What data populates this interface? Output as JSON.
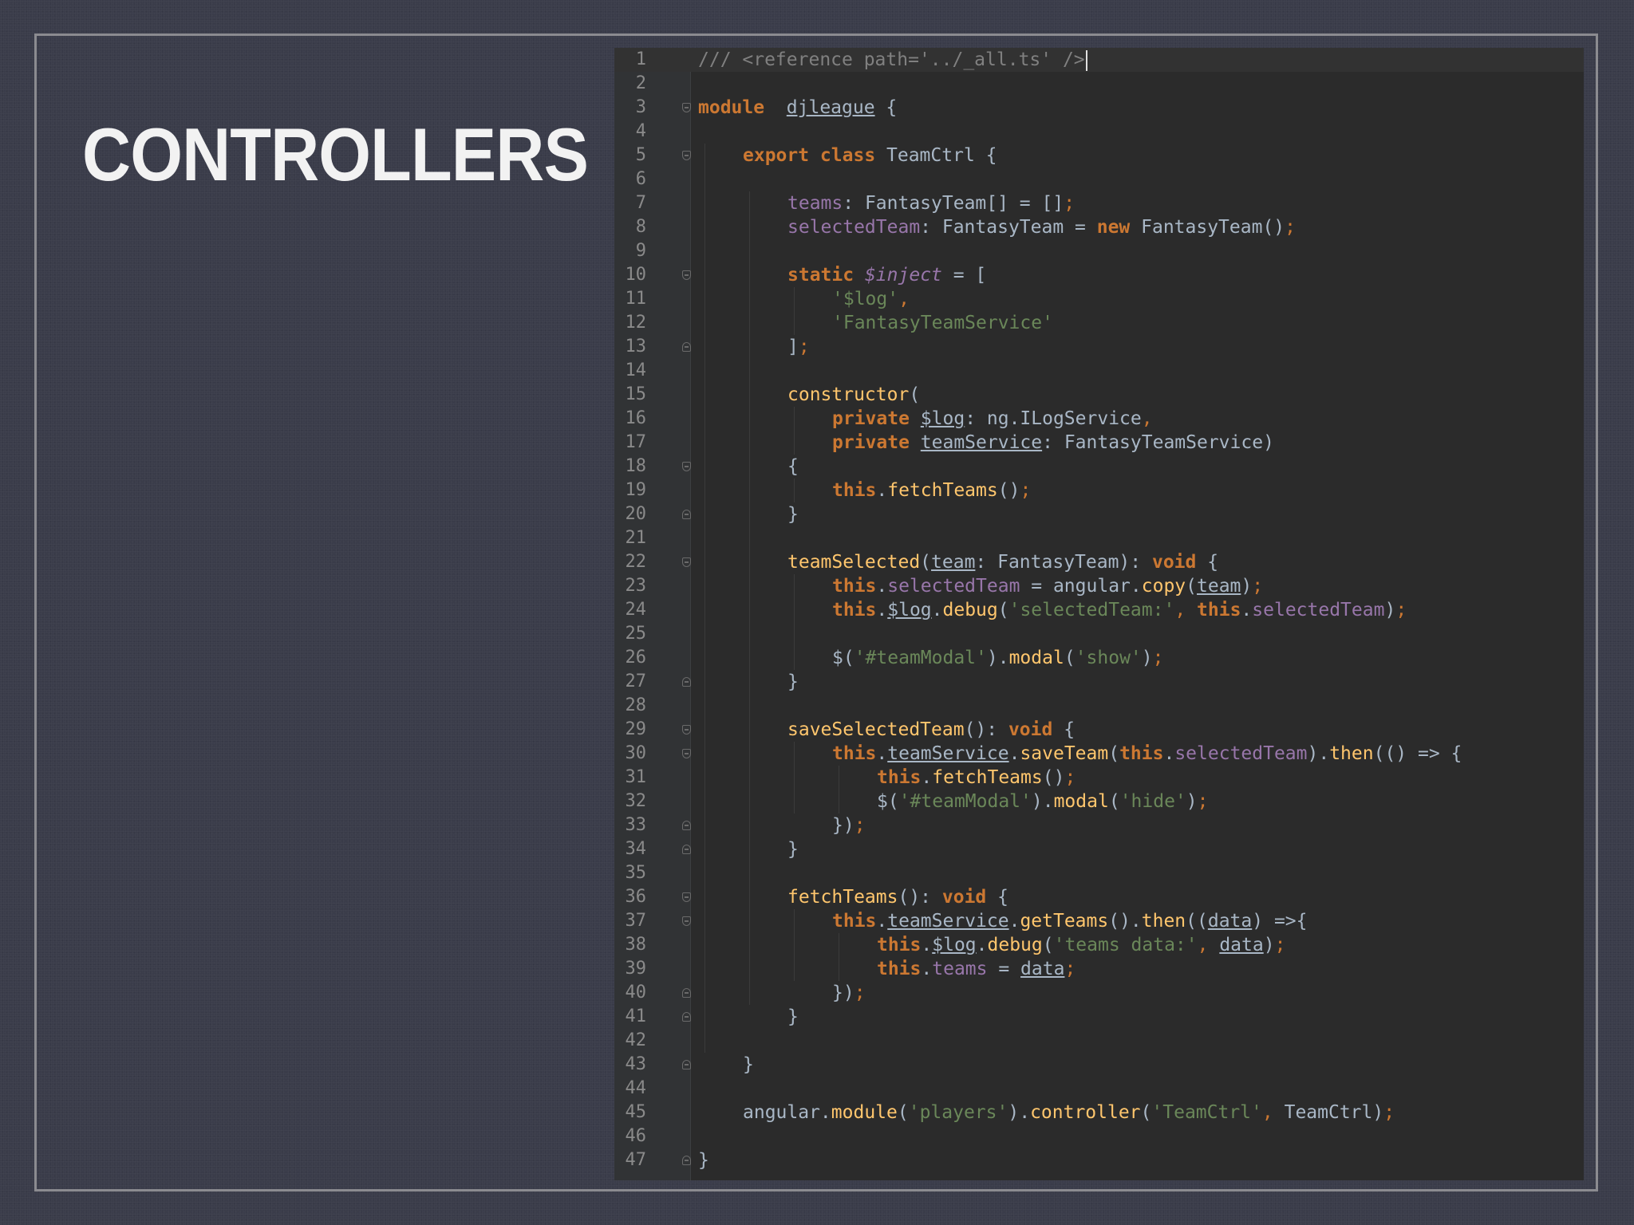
{
  "slide": {
    "title": "CONTROLLERS"
  },
  "editor": {
    "caret_line": 1,
    "lines": [
      [
        [
          "cm",
          "/// <reference path='../_all.ts' />"
        ]
      ],
      [],
      [
        [
          "kw",
          "module"
        ],
        [
          "",
          "  "
        ],
        [
          "ul",
          "djleague"
        ],
        [
          "",
          " {"
        ]
      ],
      [],
      [
        [
          "",
          ""
        ],
        [
          "kw",
          "export class"
        ],
        [
          "",
          " TeamCtrl {"
        ]
      ],
      [],
      [
        [
          "fld",
          "teams"
        ],
        [
          "",
          ": FantasyTeam[] = []"
        ],
        [
          "pun",
          ";"
        ]
      ],
      [
        [
          "fld",
          "selectedTeam"
        ],
        [
          "",
          ": FantasyTeam = "
        ],
        [
          "kw",
          "new"
        ],
        [
          "",
          " FantasyTeam()"
        ],
        [
          "pun",
          ";"
        ]
      ],
      [],
      [
        [
          "kw",
          "static"
        ],
        [
          "",
          " "
        ],
        [
          "fldi",
          "$inject"
        ],
        [
          "",
          " = ["
        ]
      ],
      [
        [
          "str",
          "'$log'"
        ],
        [
          "pun",
          ","
        ]
      ],
      [
        [
          "str",
          "'FantasyTeamService'"
        ]
      ],
      [
        [
          "",
          "]"
        ],
        [
          "pun",
          ";"
        ]
      ],
      [],
      [
        [
          "fn",
          "constructor"
        ],
        [
          "",
          "("
        ]
      ],
      [
        [
          "kw",
          "private"
        ],
        [
          "",
          " "
        ],
        [
          "ul",
          "$log"
        ],
        [
          "",
          ": ng.ILogService"
        ],
        [
          "pun",
          ","
        ]
      ],
      [
        [
          "kw",
          "private"
        ],
        [
          "",
          " "
        ],
        [
          "ul",
          "teamService"
        ],
        [
          "",
          ": FantasyTeamService)"
        ]
      ],
      [
        [
          "",
          "{"
        ]
      ],
      [
        [
          "kw",
          "this"
        ],
        [
          "",
          "."
        ],
        [
          "fn",
          "fetchTeams"
        ],
        [
          "",
          "()"
        ],
        [
          "pun",
          ";"
        ]
      ],
      [
        [
          "",
          "}"
        ]
      ],
      [],
      [
        [
          "fn",
          "teamSelected"
        ],
        [
          "",
          "("
        ],
        [
          "ul",
          "team"
        ],
        [
          "",
          ": FantasyTeam): "
        ],
        [
          "kw",
          "void"
        ],
        [
          "",
          " {"
        ]
      ],
      [
        [
          "kw",
          "this"
        ],
        [
          "",
          "."
        ],
        [
          "fld",
          "selectedTeam"
        ],
        [
          "",
          " = angular."
        ],
        [
          "fn",
          "copy"
        ],
        [
          "",
          "("
        ],
        [
          "ul",
          "team"
        ],
        [
          "",
          ")"
        ],
        [
          "pun",
          ";"
        ]
      ],
      [
        [
          "kw",
          "this"
        ],
        [
          "",
          "."
        ],
        [
          "ul",
          "$log"
        ],
        [
          "",
          "."
        ],
        [
          "fn",
          "debug"
        ],
        [
          "",
          "("
        ],
        [
          "str",
          "'selectedTeam:'"
        ],
        [
          "pun",
          ", "
        ],
        [
          "kw",
          "this"
        ],
        [
          "",
          "."
        ],
        [
          "fld",
          "selectedTeam"
        ],
        [
          "",
          ")"
        ],
        [
          "pun",
          ";"
        ]
      ],
      [],
      [
        [
          "",
          "$("
        ],
        [
          "str",
          "'#teamModal'"
        ],
        [
          "",
          ")."
        ],
        [
          "fn",
          "modal"
        ],
        [
          "",
          "("
        ],
        [
          "str",
          "'show'"
        ],
        [
          "",
          ")"
        ],
        [
          "pun",
          ";"
        ]
      ],
      [
        [
          "",
          "}"
        ]
      ],
      [],
      [
        [
          "fn",
          "saveSelectedTeam"
        ],
        [
          "",
          "(): "
        ],
        [
          "kw",
          "void"
        ],
        [
          "",
          " {"
        ]
      ],
      [
        [
          "kw",
          "this"
        ],
        [
          "",
          "."
        ],
        [
          "ul",
          "teamService"
        ],
        [
          "",
          "."
        ],
        [
          "fn",
          "saveTeam"
        ],
        [
          "",
          "("
        ],
        [
          "kw",
          "this"
        ],
        [
          "",
          "."
        ],
        [
          "fld",
          "selectedTeam"
        ],
        [
          "",
          ")."
        ],
        [
          "fn",
          "then"
        ],
        [
          "",
          "(() => {"
        ]
      ],
      [
        [
          "kw",
          "this"
        ],
        [
          "",
          "."
        ],
        [
          "fn",
          "fetchTeams"
        ],
        [
          "",
          "()"
        ],
        [
          "pun",
          ";"
        ]
      ],
      [
        [
          "",
          "$("
        ],
        [
          "str",
          "'#teamModal'"
        ],
        [
          "",
          ")."
        ],
        [
          "fn",
          "modal"
        ],
        [
          "",
          "("
        ],
        [
          "str",
          "'hide'"
        ],
        [
          "",
          ")"
        ],
        [
          "pun",
          ";"
        ]
      ],
      [
        [
          "",
          "})"
        ],
        [
          "pun",
          ";"
        ]
      ],
      [
        [
          "",
          "}"
        ]
      ],
      [],
      [
        [
          "fn",
          "fetchTeams"
        ],
        [
          "",
          "(): "
        ],
        [
          "kw",
          "void"
        ],
        [
          "",
          " {"
        ]
      ],
      [
        [
          "kw",
          "this"
        ],
        [
          "",
          "."
        ],
        [
          "ul",
          "teamService"
        ],
        [
          "",
          "."
        ],
        [
          "fn",
          "getTeams"
        ],
        [
          "",
          "()."
        ],
        [
          "fn",
          "then"
        ],
        [
          "",
          "(("
        ],
        [
          "ul",
          "data"
        ],
        [
          "",
          ") =>{"
        ]
      ],
      [
        [
          "kw",
          "this"
        ],
        [
          "",
          "."
        ],
        [
          "ul",
          "$log"
        ],
        [
          "",
          "."
        ],
        [
          "fn",
          "debug"
        ],
        [
          "",
          "("
        ],
        [
          "str",
          "'teams data:'"
        ],
        [
          "pun",
          ", "
        ],
        [
          "ul",
          "data"
        ],
        [
          "",
          ")"
        ],
        [
          "pun",
          ";"
        ]
      ],
      [
        [
          "kw",
          "this"
        ],
        [
          "",
          "."
        ],
        [
          "fld",
          "teams"
        ],
        [
          "",
          " = "
        ],
        [
          "ul",
          "data"
        ],
        [
          "pun",
          ";"
        ]
      ],
      [
        [
          "",
          "})"
        ],
        [
          "pun",
          ";"
        ]
      ],
      [
        [
          "",
          "}"
        ]
      ],
      [],
      [
        [
          "",
          "}"
        ]
      ],
      [],
      [
        [
          "",
          "angular."
        ],
        [
          "fn",
          "module"
        ],
        [
          "",
          "("
        ],
        [
          "str",
          "'players'"
        ],
        [
          "",
          ")."
        ],
        [
          "fn",
          "controller"
        ],
        [
          "",
          "("
        ],
        [
          "str",
          "'TeamCtrl'"
        ],
        [
          "pun",
          ", "
        ],
        [
          "",
          "TeamCtrl)"
        ],
        [
          "pun",
          ";"
        ]
      ],
      [],
      [
        [
          "",
          "}"
        ]
      ]
    ]
  }
}
